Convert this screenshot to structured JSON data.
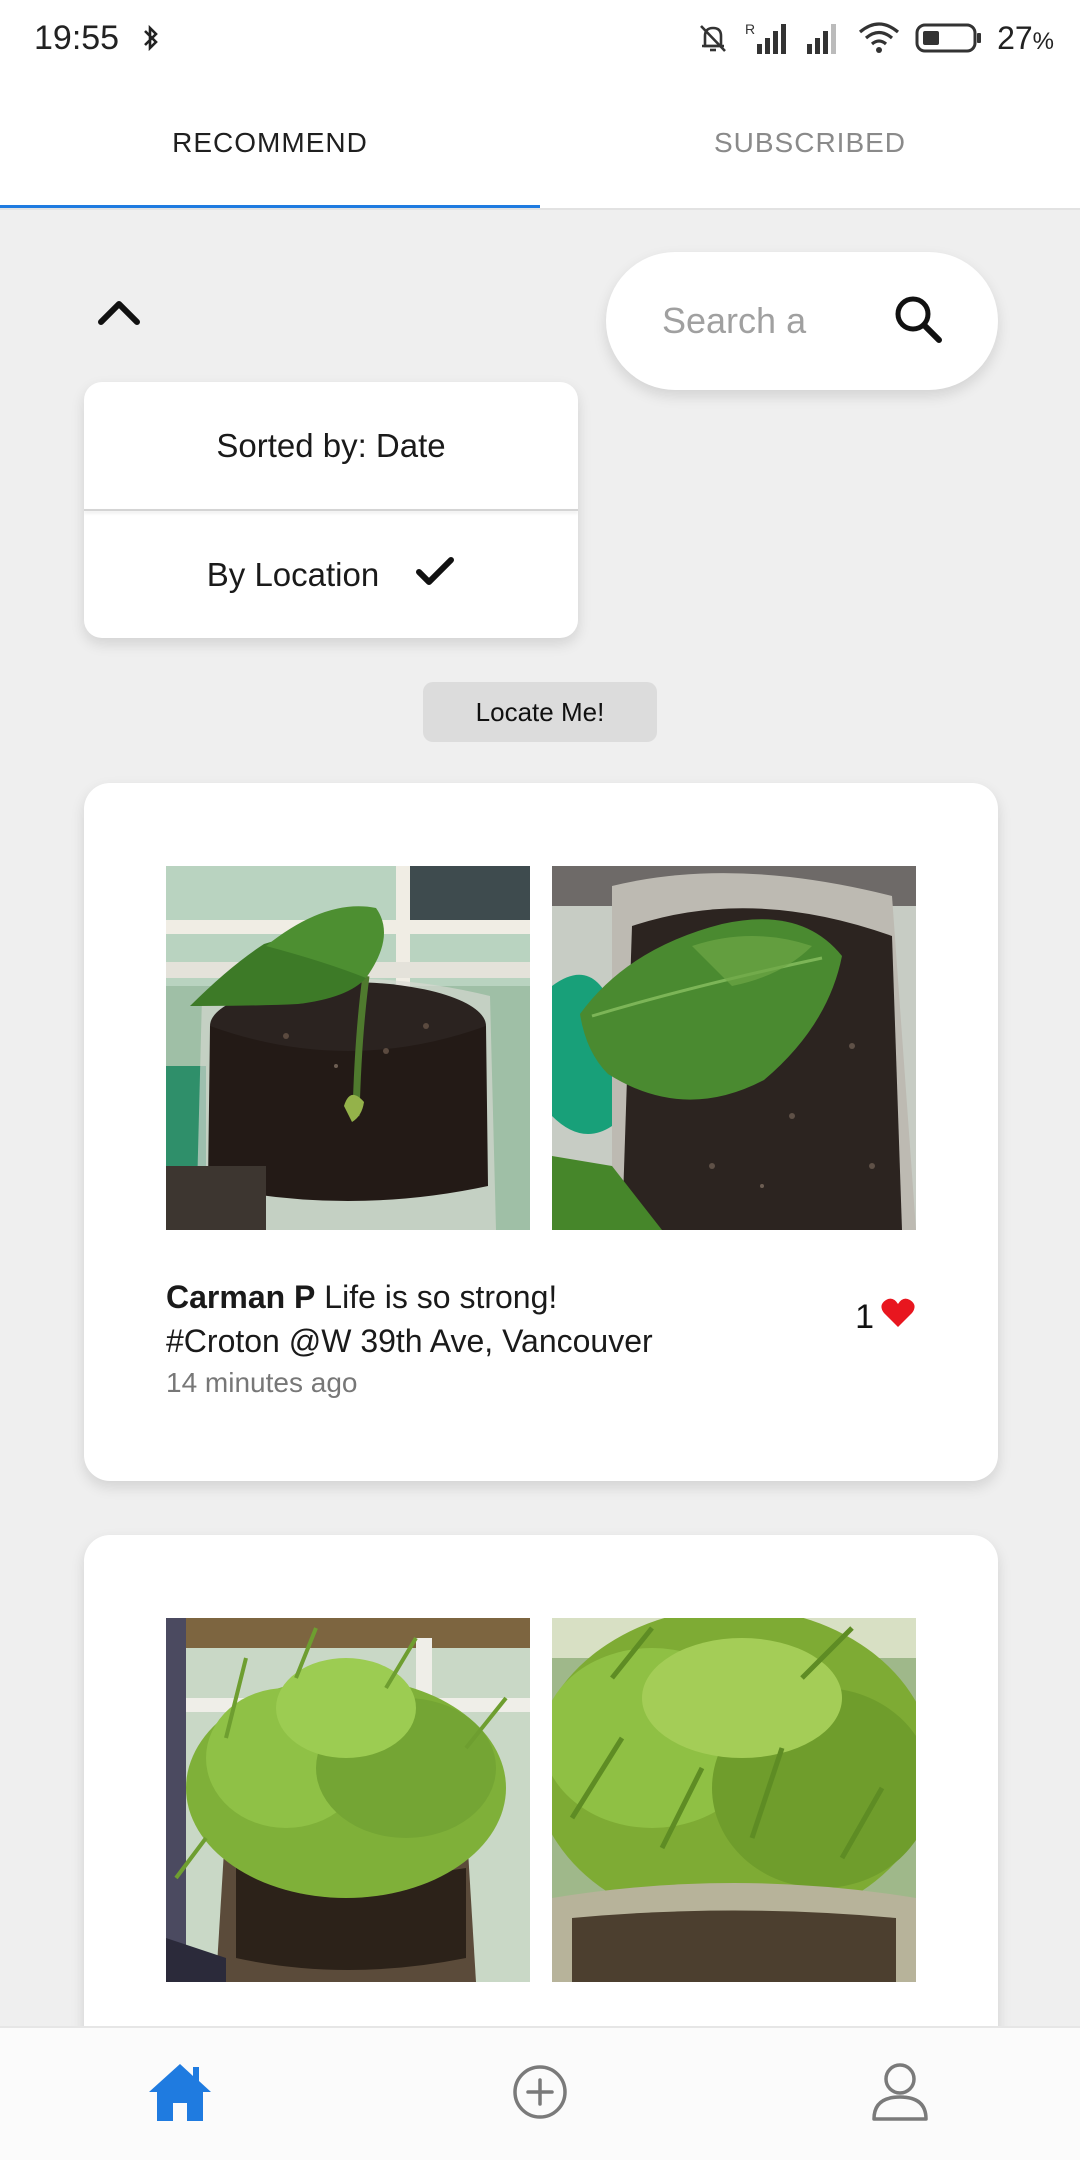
{
  "status_bar": {
    "time": "19:55",
    "battery_percent": "27",
    "battery_unit": "%",
    "icons": [
      "bluetooth-icon",
      "mute-icon",
      "signal-r-icon",
      "signal-icon",
      "wifi-icon",
      "battery-icon"
    ]
  },
  "tabs": [
    {
      "label": "RECOMMEND",
      "active": true
    },
    {
      "label": "SUBSCRIBED",
      "active": false
    }
  ],
  "search": {
    "placeholder": "Search a",
    "value": ""
  },
  "sort_menu": {
    "items": [
      {
        "label": "Sorted by: Date",
        "checked": false
      },
      {
        "label": "By Location",
        "checked": true
      }
    ]
  },
  "locate_button": {
    "label": "Locate Me!"
  },
  "posts": [
    {
      "author": "Carman P",
      "text": "Life is so strong!",
      "tags": "#Croton @W 39th Ave, Vancouver",
      "time": "14 minutes ago",
      "likes": "1",
      "photos": [
        "pothos-cutting-photo",
        "pothos-leaf-closeup-photo"
      ]
    },
    {
      "photos": [
        "succulent-jar-photo",
        "succulent-closeup-photo"
      ]
    }
  ],
  "bottom_nav": [
    {
      "icon": "home-icon",
      "active": true
    },
    {
      "icon": "add-circle-icon",
      "active": false
    },
    {
      "icon": "profile-icon",
      "active": false
    }
  ],
  "colors": {
    "accent": "#1f7be0",
    "like": "#e8161f",
    "background": "#efefef"
  }
}
